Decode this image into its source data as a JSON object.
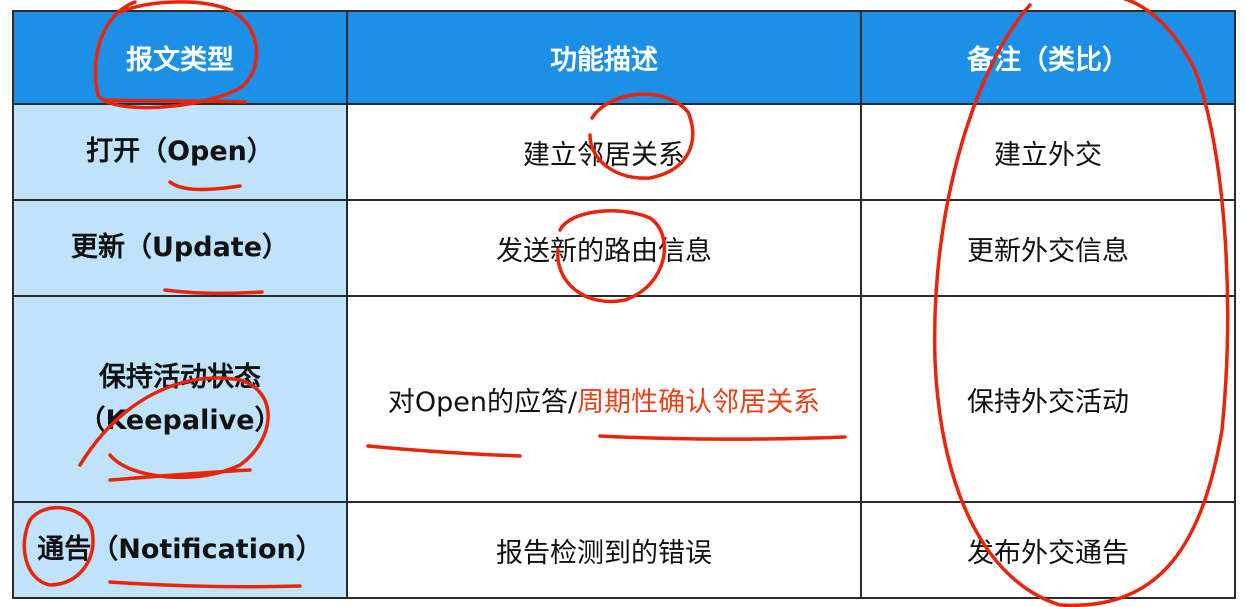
{
  "table": {
    "headers": {
      "type": "报文类型",
      "function": "功能描述",
      "note": "备注（类比）"
    },
    "rows": [
      {
        "type": "打开（Open）",
        "function": "建立邻居关系",
        "note": "建立外交"
      },
      {
        "type": "更新（Update）",
        "function": "发送新的路由信息",
        "note": "更新外交信息"
      },
      {
        "type_line1": "保持活动状态",
        "type_line2": "（Keepalive）",
        "function_part1": "对Open的应答/",
        "function_part2": "周期性确认邻居关系",
        "note": "保持外交活动"
      },
      {
        "type": "通告（Notification）",
        "function": "报告检测到的错误",
        "note": "发布外交通告"
      }
    ]
  },
  "colors": {
    "header_bg": "#1e8fe6",
    "type_col_bg": "#bfe3fb",
    "highlight_text": "#e8421b",
    "annotation_ink": "#e8250a"
  }
}
